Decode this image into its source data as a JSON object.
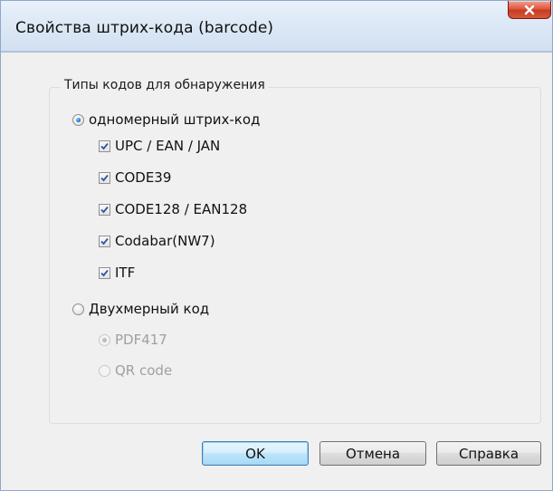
{
  "window": {
    "title": "Свойства штрих-кода (barcode)"
  },
  "group": {
    "legend": "Типы кодов для обнаружения"
  },
  "options": {
    "one_d": {
      "label": "одномерный штрих-код",
      "selected": true
    },
    "one_d_types": [
      {
        "label": "UPC / EAN / JAN",
        "checked": true
      },
      {
        "label": "CODE39",
        "checked": true
      },
      {
        "label": "CODE128 / EAN128",
        "checked": true
      },
      {
        "label": "Codabar(NW7)",
        "checked": true
      },
      {
        "label": "ITF",
        "checked": true
      }
    ],
    "two_d": {
      "label": "Двухмерный код",
      "selected": false
    },
    "two_d_types": [
      {
        "label": "PDF417",
        "selected": true,
        "enabled": false
      },
      {
        "label": "QR code",
        "selected": false,
        "enabled": false
      }
    ]
  },
  "buttons": {
    "ok": "OK",
    "cancel": "Отмена",
    "help": "Справка"
  },
  "colors": {
    "close_button": "#d55a3b",
    "default_button_border": "#3c7fb1",
    "dialog_background": "#f0f0f0",
    "check_mark": "#2b56a8"
  }
}
